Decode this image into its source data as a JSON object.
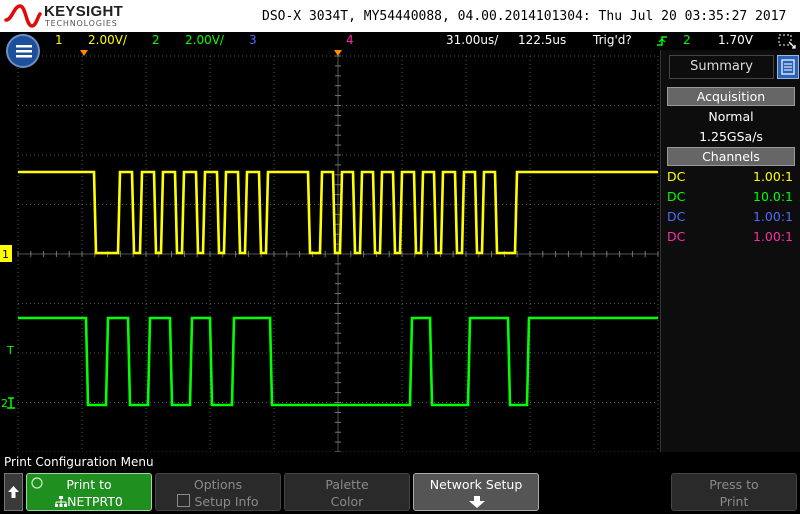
{
  "header": {
    "brand": "KEYSIGHT",
    "brand_sub": "TECHNOLOGIES",
    "instrument_info": "DSO-X 3034T, MY54440088, 04.00.2014101304: Thu Jul 20 03:35:27 2017"
  },
  "status": {
    "ch1_num": "1",
    "ch1_scale": "2.00V/",
    "ch2_num": "2",
    "ch2_scale": "2.00V/",
    "ch3_num": "3",
    "ch4_num": "4",
    "time_per_div": "31.00us/",
    "delay": "122.5us",
    "trigger_state": "Trig'd?",
    "trigger_channel": "2",
    "trigger_level": "1.70V"
  },
  "screen": {
    "ch1_marker": "1",
    "ch2_marker": "2",
    "trigger_marker": "T"
  },
  "side_panel": {
    "title": "Summary",
    "acquisition_header": "Acquisition",
    "acquisition_mode": "Normal",
    "sample_rate": "1.25GSa/s",
    "channels_header": "Channels",
    "channels": [
      {
        "coupling": "DC",
        "ratio": "1.00:1",
        "color": "#ffff00"
      },
      {
        "coupling": "DC",
        "ratio": "10.0:1",
        "color": "#00ff00"
      },
      {
        "coupling": "DC",
        "ratio": "1.00:1",
        "color": "#4f6bff"
      },
      {
        "coupling": "DC",
        "ratio": "1.00:1",
        "color": "#ff2aa8"
      }
    ]
  },
  "softkeys": {
    "menu_title": "Print Configuration Menu",
    "print_to_label": "Print to",
    "print_to_value": "NETPRT0",
    "options_label": "Options",
    "options_value": "Setup Info",
    "palette_label": "Palette",
    "palette_value": "Color",
    "network_setup_label": "Network Setup",
    "press_to_label": "Press to",
    "press_to_value": "Print"
  },
  "colors": {
    "ch1": "#ffff00",
    "ch2": "#00ff00",
    "ch3": "#4f6bff",
    "ch4": "#ff2aa8",
    "grid": "#5a5a5a",
    "brand_red": "#e10a0a",
    "menu_blue": "#1d4f9a",
    "softkey_green": "#1f8f1f"
  }
}
